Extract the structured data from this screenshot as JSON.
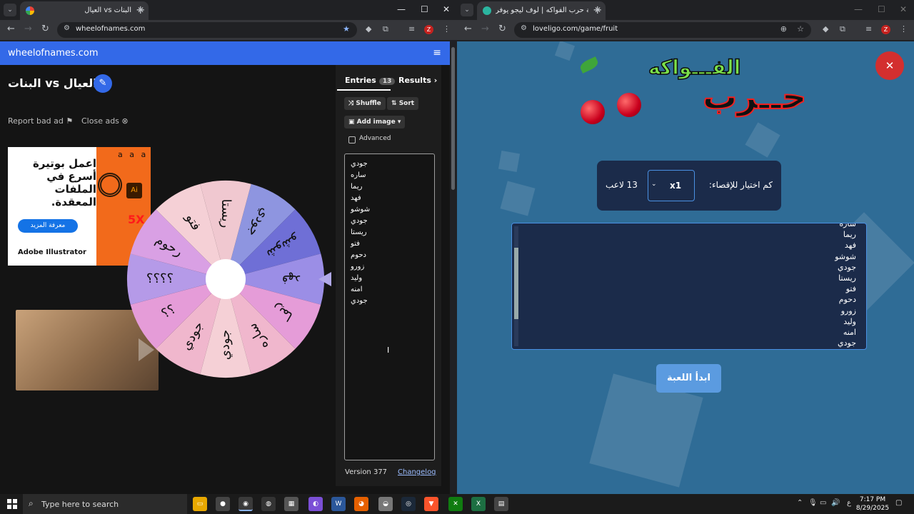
{
  "left_window": {
    "tab_title": "العيال vs البنات",
    "url": "wheelofnames.com",
    "site": {
      "brand": "wheelofnames.com",
      "wheel_title": "البنات vs العيال",
      "report_ad": "Report bad ad",
      "close_ads": "Close ads",
      "ad": {
        "headline": "اعمل بوتيرة أسرع في الملفات المعقدة.",
        "cta": "معرفة المزيد",
        "brand": "Adobe Illustrator",
        "art_text": "a a a",
        "art_badge": "Ai",
        "art_5x": "5X"
      },
      "tabs": {
        "entries": "Entries",
        "entries_count": "13",
        "results": "Results"
      },
      "buttons": {
        "shuffle": "Shuffle",
        "sort": "Sort",
        "add_image": "Add image",
        "advanced": "Advanced"
      },
      "entries": [
        "جودي",
        "ساره",
        "ريما",
        "فهد",
        "شوشو",
        "جودي",
        "ريستا",
        "فتو",
        "دحوم",
        "زورو",
        "وليد",
        "امنه",
        "جودي"
      ],
      "version": "Version 377",
      "changelog": "Changelog"
    },
    "wheel_segments": [
      "جودي",
      "شوشو",
      "فهد",
      "ريما",
      "ساره",
      "جودي",
      "جودي",
      "؟؟",
      "؟؟؟؟",
      "رحوم",
      "فتو",
      "ريستا"
    ],
    "colors": {
      "header": "#3369e8",
      "segments": [
        "#8e95e0",
        "#6f6fd6",
        "#9b8ee6",
        "#e59cd8",
        "#f0b7cd",
        "#f5d0d6",
        "#f0b7cd",
        "#e59cd8",
        "#b59ae8",
        "#d9a0e4",
        "#f5d0d6",
        "#f0c8d0"
      ]
    }
  },
  "right_window": {
    "tab_title": "لعبة حرب الفواكه | لوف ليجو يوفر",
    "url": "loveligo.com/game/fruit",
    "logo_top": "الفـــواكه",
    "logo_bottom": "حــرب",
    "elimination_label": "كم اختيار للإقصاء:",
    "elimination_value": "x1",
    "players": "13 لاعب",
    "players_list": [
      "ساره",
      "ريما",
      "فهد",
      "شوشو",
      "جودي",
      "ريستا",
      "فتو",
      "دحوم",
      "زورو",
      "وليد",
      "امنه",
      "جودي"
    ],
    "start_button": "ابدأ اللعبة",
    "colors": {
      "bg": "#2f6c96",
      "panel": "#1b2b4a",
      "button": "#5b9be0",
      "close": "#d32f2f"
    }
  },
  "taskbar": {
    "search_placeholder": "Type here to search",
    "lang": "ع",
    "time": "7:17 PM",
    "date": "8/29/2025"
  }
}
